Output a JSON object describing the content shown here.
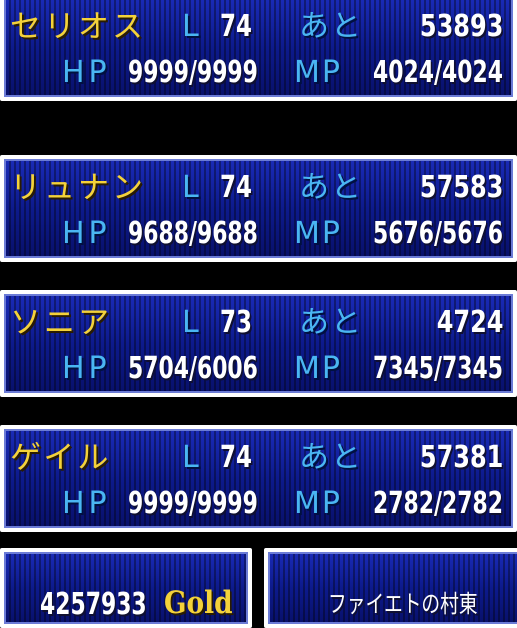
{
  "party": [
    {
      "name": "セリオス",
      "level_label": "L",
      "level": "74",
      "next_label": "あと",
      "next_exp": "53893",
      "hp_label": "HP",
      "hp": "9999/9999",
      "mp_label": "MP",
      "mp": "4024/4024"
    },
    {
      "name": "リュナン",
      "level_label": "L",
      "level": "74",
      "next_label": "あと",
      "next_exp": "57583",
      "hp_label": "HP",
      "hp": "9688/9688",
      "mp_label": "MP",
      "mp": "5676/5676"
    },
    {
      "name": "ソニア",
      "level_label": "L",
      "level": "73",
      "next_label": "あと",
      "next_exp": "4724",
      "hp_label": "HP",
      "hp": "5704/6006",
      "mp_label": "MP",
      "mp": "7345/7345"
    },
    {
      "name": "ゲイル",
      "level_label": "L",
      "level": "74",
      "next_label": "あと",
      "next_exp": "57381",
      "hp_label": "HP",
      "hp": "9999/9999",
      "mp_label": "MP",
      "mp": "2782/2782"
    }
  ],
  "gold": {
    "amount": "4257933",
    "label": "Gold"
  },
  "info": {
    "text": "ファイエトの村東"
  },
  "colors": {
    "name": "#f4d23a",
    "label": "#4ab6f2",
    "value": "#ffffff",
    "panel": "#0c1370",
    "border": "#ffffff"
  }
}
